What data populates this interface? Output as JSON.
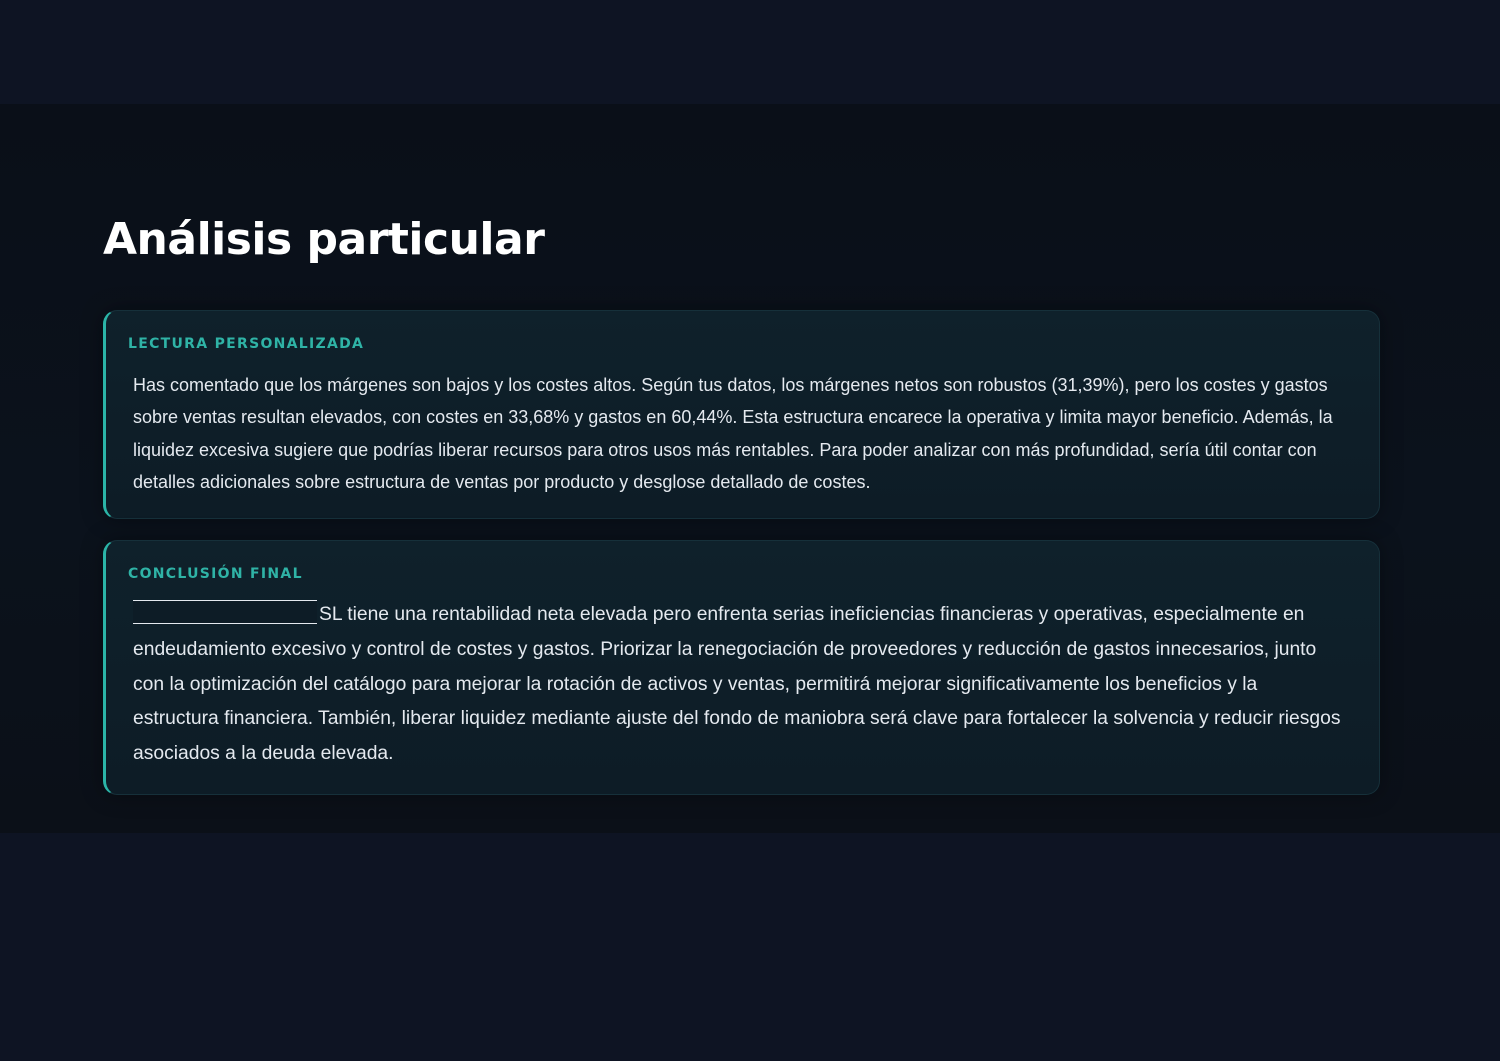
{
  "page": {
    "title": "Análisis particular"
  },
  "personalized_reading": {
    "label": "LECTURA PERSONALIZADA",
    "text": "Has comentado que los márgenes son bajos y los costes altos. Según tus datos, los márgenes netos son robustos (31,39%), pero los costes y gastos sobre ventas resultan elevados, con costes en 33,68% y gastos en 60,44%. Esta estructura encarece la operativa y limita mayor beneficio. Además, la liquidez excesiva sugiere que podrías liberar recursos para otros usos más rentables. Para poder analizar con más profundidad, sería útil contar con detalles adicionales sobre estructura de ventas por producto y desglose detallado de costes."
  },
  "final_conclusion": {
    "label": "CONCLUSIÓN FINAL",
    "text": "SL tiene una rentabilidad neta elevada pero enfrenta serias ineficiencias financieras y operativas, especialmente en endeudamiento excesivo y control de costes y gastos. Priorizar la renegociación de proveedores y reducción de gastos innecesarios, junto con la optimización del catálogo para mejorar la rotación de activos y ventas, permitirá mejorar significativamente los beneficios y la estructura financiera. También, liberar liquidez mediante ajuste del fondo de maniobra será clave para fortalecer la solvencia y reducir riesgos asociados a la deuda elevada."
  }
}
